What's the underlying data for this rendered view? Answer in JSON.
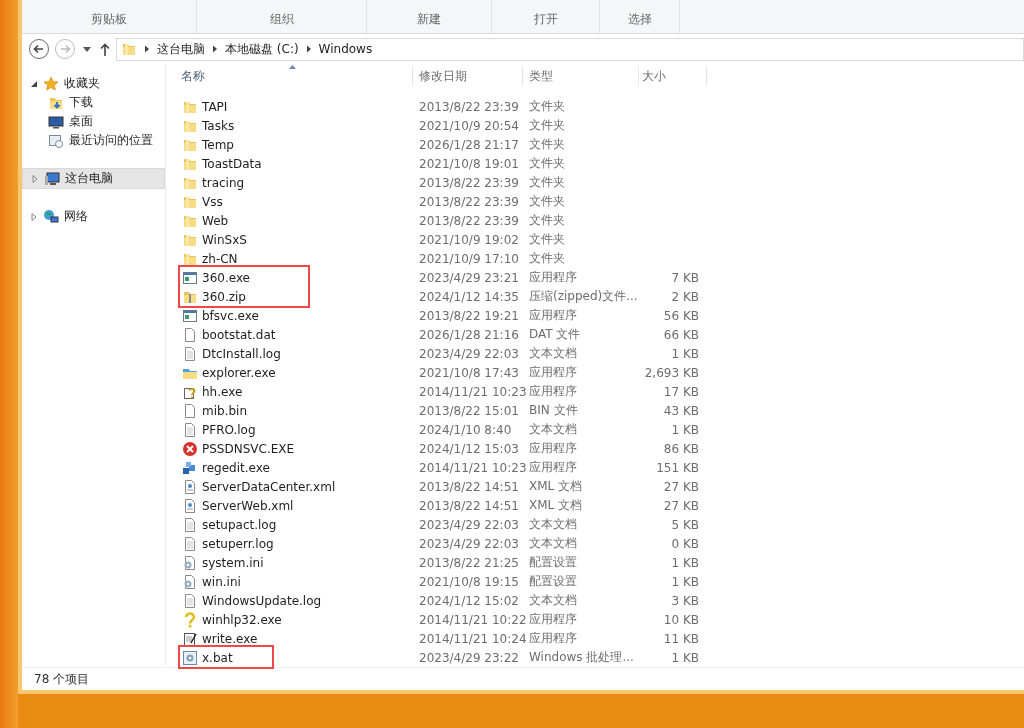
{
  "ribbon": {
    "groups": [
      "剪贴板",
      "组织",
      "新建",
      "打开",
      "选择"
    ]
  },
  "address_bar": {
    "path": [
      "这台电脑",
      "本地磁盘 (C:)",
      "Windows"
    ]
  },
  "nav_pane": {
    "sections": [
      {
        "label": "收藏夹",
        "kind": "star",
        "expanded": true,
        "selected": false,
        "children": [
          {
            "label": "下载",
            "kind": "download",
            "selected": false
          },
          {
            "label": "桌面",
            "kind": "desktop",
            "selected": false
          },
          {
            "label": "最近访问的位置",
            "kind": "recent",
            "selected": false
          }
        ]
      },
      {
        "label": "这台电脑",
        "kind": "computer",
        "expanded": false,
        "selected": true
      },
      {
        "label": "网络",
        "kind": "network",
        "expanded": false,
        "selected": false
      }
    ]
  },
  "file_list": {
    "columns": [
      {
        "label": "名称",
        "sorted": true
      },
      {
        "label": "修改日期",
        "sorted": false
      },
      {
        "label": "类型",
        "sorted": false
      },
      {
        "label": "大小",
        "sorted": false
      }
    ],
    "rows": [
      {
        "name": "TAPI",
        "kind": "folder",
        "date": "2013/8/22 23:39",
        "type": "文件夹",
        "highlight": false
      },
      {
        "name": "Tasks",
        "kind": "folder",
        "date": "2021/10/9 20:54",
        "type": "文件夹",
        "highlight": false
      },
      {
        "name": "Temp",
        "kind": "folder",
        "date": "2026/1/28 21:17",
        "type": "文件夹",
        "highlight": false
      },
      {
        "name": "ToastData",
        "kind": "folder",
        "date": "2021/10/8 19:01",
        "type": "文件夹",
        "highlight": false
      },
      {
        "name": "tracing",
        "kind": "folder",
        "date": "2013/8/22 23:39",
        "type": "文件夹",
        "highlight": false
      },
      {
        "name": "Vss",
        "kind": "folder",
        "date": "2013/8/22 23:39",
        "type": "文件夹",
        "highlight": false
      },
      {
        "name": "Web",
        "kind": "folder",
        "date": "2013/8/22 23:39",
        "type": "文件夹",
        "highlight": false
      },
      {
        "name": "WinSxS",
        "kind": "folder",
        "date": "2021/10/9 19:02",
        "type": "文件夹",
        "highlight": false
      },
      {
        "name": "zh-CN",
        "kind": "folder",
        "date": "2021/10/9 17:10",
        "type": "文件夹",
        "highlight": false
      },
      {
        "name": "360.exe",
        "kind": "exe",
        "date": "2023/4/29 23:21",
        "type": "应用程序",
        "size": "7 KB",
        "highlight": true
      },
      {
        "name": "360.zip",
        "kind": "zip",
        "date": "2024/1/12 14:35",
        "type": "压缩(zipped)文件...",
        "size": "2 KB",
        "highlight": true
      },
      {
        "name": "bfsvc.exe",
        "kind": "exe",
        "date": "2013/8/22 19:21",
        "type": "应用程序",
        "size": "56 KB",
        "highlight": false
      },
      {
        "name": "bootstat.dat",
        "kind": "file",
        "date": "2026/1/28 21:16",
        "type": "DAT 文件",
        "size": "66 KB",
        "highlight": false
      },
      {
        "name": "DtcInstall.log",
        "kind": "text",
        "date": "2023/4/29 22:03",
        "type": "文本文档",
        "size": "1 KB",
        "highlight": false
      },
      {
        "name": "explorer.exe",
        "kind": "explorer",
        "date": "2021/10/8 17:43",
        "type": "应用程序",
        "size": "2,693 KB",
        "highlight": false
      },
      {
        "name": "hh.exe",
        "kind": "help",
        "date": "2014/11/21 10:23",
        "type": "应用程序",
        "size": "17 KB",
        "highlight": false
      },
      {
        "name": "mib.bin",
        "kind": "file",
        "date": "2013/8/22 15:01",
        "type": "BIN 文件",
        "size": "43 KB",
        "highlight": false
      },
      {
        "name": "PFRO.log",
        "kind": "text",
        "date": "2024/1/10 8:40",
        "type": "文本文档",
        "size": "1 KB",
        "highlight": false
      },
      {
        "name": "PSSDNSVC.EXE",
        "kind": "error",
        "date": "2024/1/12 15:03",
        "type": "应用程序",
        "size": "86 KB",
        "highlight": false
      },
      {
        "name": "regedit.exe",
        "kind": "regedit",
        "date": "2014/11/21 10:23",
        "type": "应用程序",
        "size": "151 KB",
        "highlight": false
      },
      {
        "name": "ServerDataCenter.xml",
        "kind": "xml",
        "date": "2013/8/22 14:51",
        "type": "XML 文档",
        "size": "27 KB",
        "highlight": false
      },
      {
        "name": "ServerWeb.xml",
        "kind": "xml",
        "date": "2013/8/22 14:51",
        "type": "XML 文档",
        "size": "27 KB",
        "highlight": false
      },
      {
        "name": "setupact.log",
        "kind": "text",
        "date": "2023/4/29 22:03",
        "type": "文本文档",
        "size": "5 KB",
        "highlight": false
      },
      {
        "name": "setuperr.log",
        "kind": "text",
        "date": "2023/4/29 22:03",
        "type": "文本文档",
        "size": "0 KB",
        "highlight": false
      },
      {
        "name": "system.ini",
        "kind": "ini",
        "date": "2013/8/22 21:25",
        "type": "配置设置",
        "size": "1 KB",
        "highlight": false
      },
      {
        "name": "win.ini",
        "kind": "ini",
        "date": "2021/10/8 19:15",
        "type": "配置设置",
        "size": "1 KB",
        "highlight": false
      },
      {
        "name": "WindowsUpdate.log",
        "kind": "text",
        "date": "2024/1/12 15:02",
        "type": "文本文档",
        "size": "3 KB",
        "highlight": false
      },
      {
        "name": "winhlp32.exe",
        "kind": "question",
        "date": "2014/11/21 10:22",
        "type": "应用程序",
        "size": "10 KB",
        "highlight": false
      },
      {
        "name": "write.exe",
        "kind": "write",
        "date": "2014/11/21 10:24",
        "type": "应用程序",
        "size": "11 KB",
        "highlight": false
      },
      {
        "name": "x.bat",
        "kind": "bat",
        "date": "2023/4/29 23:22",
        "type": "Windows 批处理...",
        "size": "1 KB",
        "highlight": true
      }
    ]
  },
  "status_bar": {
    "item_count": "78 个项目"
  }
}
